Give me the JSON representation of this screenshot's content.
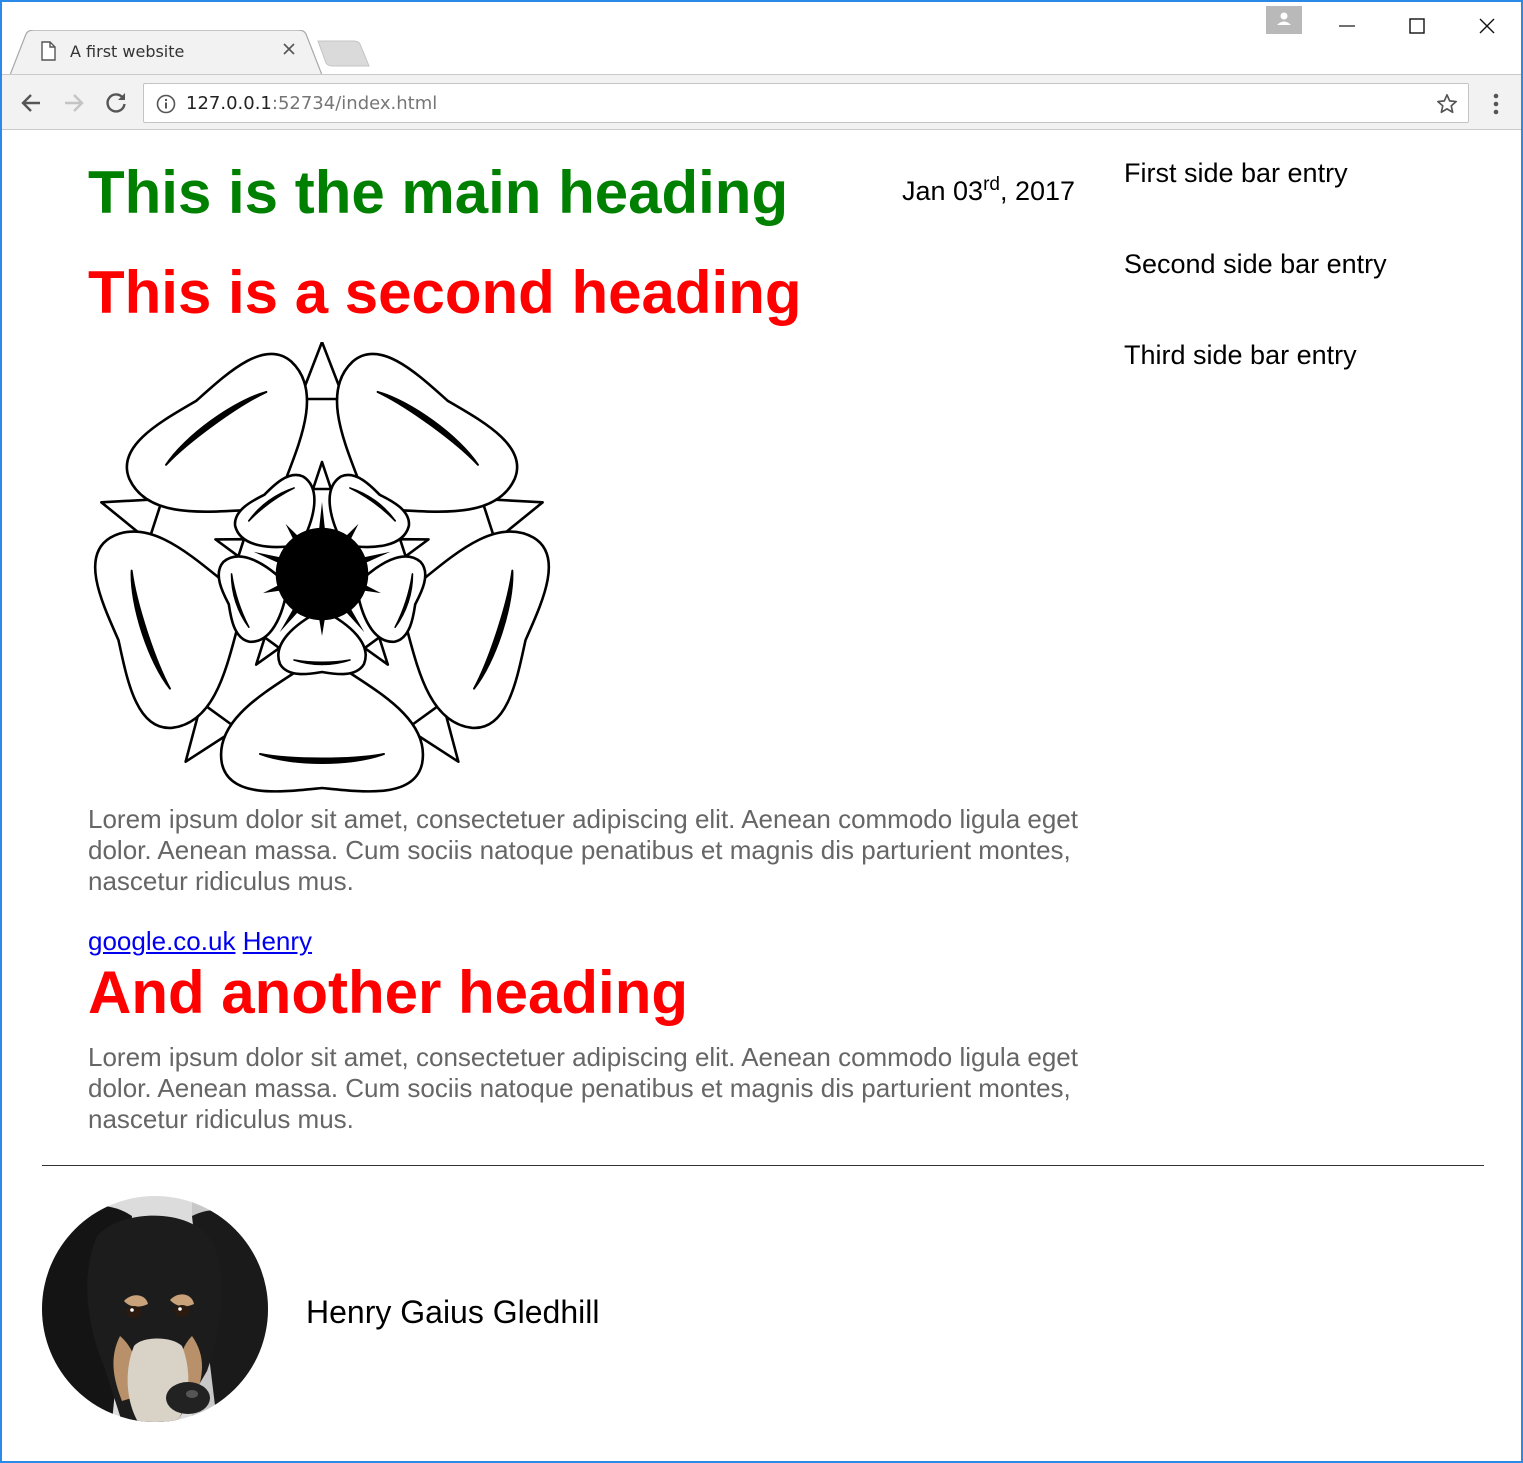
{
  "browser": {
    "tab_title": "A first website",
    "url_host": "127.0.0.1",
    "url_rest": ":52734/index.html",
    "accent_color": "#2b8ae8"
  },
  "icons": {
    "tab": "page-icon",
    "tab_close": "close-icon",
    "profile": "profile-icon",
    "minimize": "minimize-icon",
    "maximize": "maximize-icon",
    "close": "close-icon",
    "back": "back-arrow-icon",
    "forward": "forward-arrow-icon",
    "reload": "reload-icon",
    "site_info": "info-icon",
    "bookmark": "star-icon",
    "menu": "kebab-menu-icon"
  },
  "page": {
    "main_heading": "This is the main heading",
    "date_prefix": "Jan 03",
    "date_suffix": "rd",
    "date_year": ", 2017",
    "second_heading": "This is a second heading",
    "sidebar": [
      "First side bar entry",
      "Second side bar entry",
      "Third side bar entry"
    ],
    "paragraph_1": "Lorem ipsum dolor sit amet, consectetuer adipiscing elit. Aenean commodo ligula eget dolor. Aenean massa. Cum sociis natoque penatibus et magnis dis parturient montes, nascetur ridiculus mus.",
    "links": [
      "google.co.uk",
      "Henry"
    ],
    "third_heading": "And another heading",
    "paragraph_2": "Lorem ipsum dolor sit amet, consectetuer adipiscing elit. Aenean commodo ligula eget dolor. Aenean massa. Cum sociis natoque penatibus et magnis dis parturient montes, nascetur ridiculus mus.",
    "author_name": "Henry Gaius Gledhill",
    "colors": {
      "main_heading": "#008000",
      "second_heading": "#ff0000",
      "paragraph": "#666666",
      "link": "#0000ee"
    }
  }
}
